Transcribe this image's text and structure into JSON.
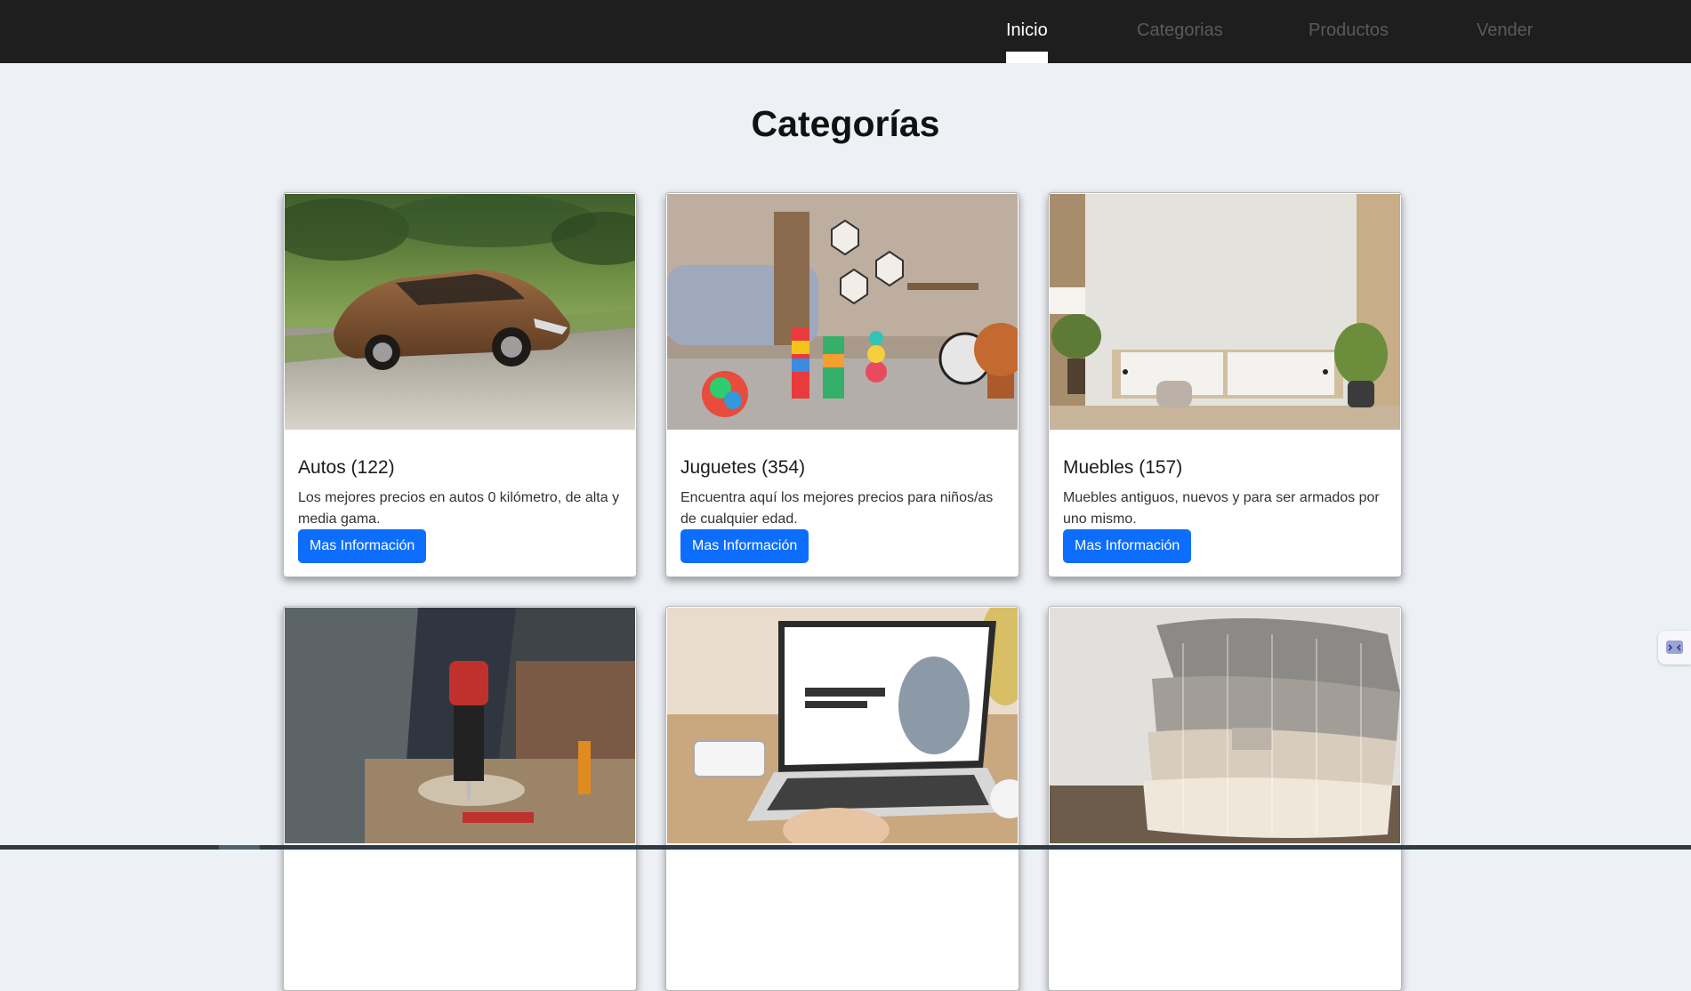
{
  "nav": {
    "items": [
      {
        "label": "Inicio",
        "active": true
      },
      {
        "label": "Categorias",
        "active": false
      },
      {
        "label": "Productos",
        "active": false
      },
      {
        "label": "Vender",
        "active": false
      }
    ]
  },
  "page": {
    "title": "Categorías"
  },
  "cards": [
    {
      "title": "Autos (122)",
      "description": "Los mejores precios en autos 0 kilómetro, de alta y media gama.",
      "button": "Mas Información",
      "image": "brown-sedan-photo"
    },
    {
      "title": "Juguetes (354)",
      "description": "Encuentra aquí los mejores precios para niños/as de cualquier edad.",
      "button": "Mas Información",
      "image": "kids-playroom-toys-photo"
    },
    {
      "title": "Muebles (157)",
      "description": "Muebles antiguos, nuevos y para ser armados por uno mismo.",
      "button": "Mas Información",
      "image": "living-room-sideboard-photo"
    },
    {
      "title": "",
      "description": "",
      "button": "",
      "image": "power-drill-workshop-photo"
    },
    {
      "title": "",
      "description": "",
      "button": "",
      "image": "laptop-on-desk-photo"
    },
    {
      "title": "",
      "description": "",
      "button": "",
      "image": "knitted-sweaters-photo"
    }
  ],
  "colors": {
    "navbar": "#1e1e1e",
    "nav_active": "#ffffff",
    "nav_inactive": "#5a5a5a",
    "background": "#edf0f5",
    "button": "#0d6efd"
  }
}
